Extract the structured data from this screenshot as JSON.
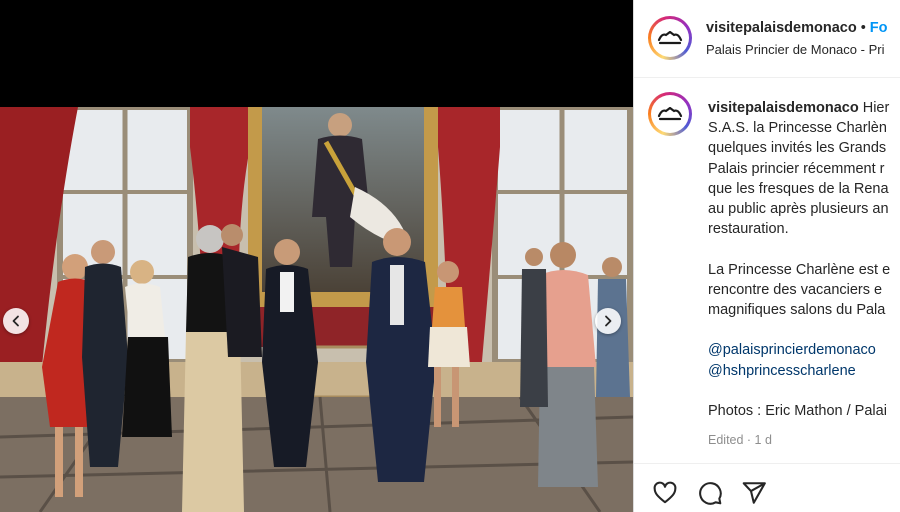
{
  "post": {
    "username": "visitepalaisdemonaco",
    "separator": "•",
    "follow_label": "Fo",
    "location": "Palais Princier de Monaco - Pri"
  },
  "caption": {
    "username": "visitepalaisdemonaco",
    "line1_rest": " Hier",
    "line2": "S.A.S. la Princesse Charlèn",
    "line3": "quelques invités les Grands",
    "line4": "Palais princier récemment r",
    "line5": "que les fresques de la Rena",
    "line6": "au public après plusieurs an",
    "line7": "restauration.",
    "line9": "La Princesse Charlène est e",
    "line10": "rencontre des vacanciers e",
    "line11": "magnifiques salons du Pala",
    "mention1": "@palaisprincierdemonaco",
    "mention2": "@hshprincesscharlene",
    "photos_credit": "Photos : Eric Mathon / Palai"
  },
  "edited": "Edited · 1 d",
  "icons": {
    "prev": "chevron-left-icon",
    "next": "chevron-right-icon",
    "like": "heart-icon",
    "comment": "comment-bubble-icon",
    "share": "paper-plane-icon",
    "avatar": "crown-logo-icon"
  },
  "colors": {
    "link_blue": "#0095f6",
    "mention": "#00376b",
    "muted": "#8e8e8e",
    "text": "#262626"
  }
}
